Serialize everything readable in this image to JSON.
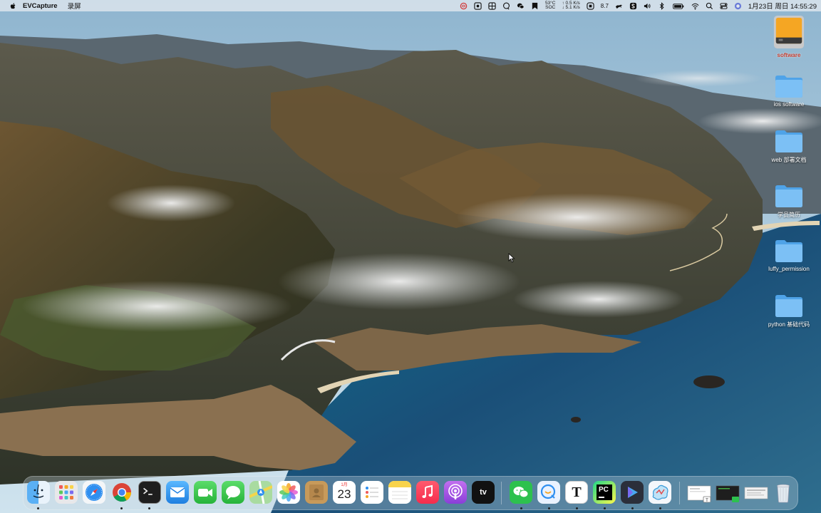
{
  "menubar": {
    "app_name": "EVCapture",
    "menu_item": "录屏",
    "temp": "53°C",
    "temp_sub": "SOC",
    "net_up": "↑ 0.5 K/s",
    "net_down": "↓ 5.1 K/s",
    "speed": "8.7",
    "datetime": "1月23日 周日  14:55:29"
  },
  "desktop_icons": [
    {
      "label": "software"
    },
    {
      "label": "ios software"
    },
    {
      "label": "web 部署文档"
    },
    {
      "label": "学员简历"
    },
    {
      "label": "luffy_permission"
    },
    {
      "label": "python 基础代码"
    }
  ],
  "dock": {
    "apps": [
      {
        "name": "finder-icon"
      },
      {
        "name": "launchpad-icon"
      },
      {
        "name": "safari-icon"
      },
      {
        "name": "chrome-icon"
      },
      {
        "name": "terminal-icon"
      },
      {
        "name": "mail-icon"
      },
      {
        "name": "facetime-icon"
      },
      {
        "name": "messages-icon"
      },
      {
        "name": "maps-icon"
      },
      {
        "name": "photos-icon"
      },
      {
        "name": "contacts-icon"
      },
      {
        "name": "calendar-icon"
      },
      {
        "name": "reminders-icon"
      },
      {
        "name": "notes-icon"
      },
      {
        "name": "music-icon"
      },
      {
        "name": "podcasts-icon"
      },
      {
        "name": "apple-tv-icon"
      },
      {
        "name": "wechat-icon"
      },
      {
        "name": "qq-icon"
      },
      {
        "name": "typora-icon"
      },
      {
        "name": "pycharm-icon"
      },
      {
        "name": "screen-recorder-icon"
      },
      {
        "name": "evcapture-icon"
      },
      {
        "name": "trash-icon"
      }
    ],
    "calendar_month": "1月",
    "calendar_day": "23",
    "tv_label": "tv",
    "typora_letter": "T",
    "pycharm_letters": "PC"
  },
  "colors": {
    "folder_blue": "#6ab4f2",
    "sky": "#a9cfe6",
    "ocean": "#1c6e92",
    "mountain": "#5b4a2c",
    "selected_label": "#c0392b"
  }
}
